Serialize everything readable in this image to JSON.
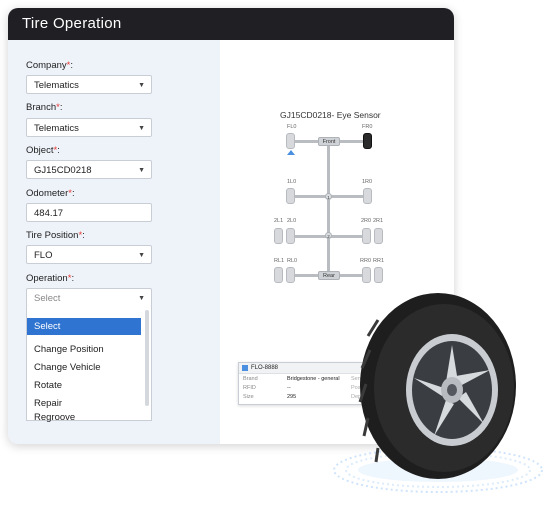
{
  "window": {
    "title": "Tire Operation"
  },
  "form": {
    "company": {
      "label": "Company",
      "required": "*",
      "suffix": ":",
      "value": "Telematics"
    },
    "branch": {
      "label": "Branch",
      "required": "*",
      "suffix": ":",
      "value": "Telematics"
    },
    "object": {
      "label": "Object",
      "required": "*",
      "suffix": ":",
      "value": "GJ15CD0218"
    },
    "odometer": {
      "label": "Odometer",
      "required": "*",
      "suffix": ":",
      "value": "484.17"
    },
    "tire_position": {
      "label": "Tire Position",
      "required": "*",
      "suffix": ":",
      "value": "FLO"
    },
    "operation": {
      "label": "Operation",
      "required": "*",
      "suffix": ":",
      "placeholder": "Select",
      "options": [
        "Select",
        "Change Position",
        "Change Vehicle",
        "Rotate",
        "Repair",
        "Regroove"
      ],
      "selected": "Select"
    }
  },
  "diagram": {
    "title": "GJ15CD0218- Eye Sensor",
    "tires": {
      "FL0": "FL0",
      "FR0": "FR0",
      "1L0": "1L0",
      "1R0": "1R0",
      "2L1": "2L1",
      "2L0": "2L0",
      "2R0": "2R0",
      "2R1": "2R1",
      "RL1": "RL1",
      "RL0": "RL0",
      "RR0": "RR0",
      "RR1": "RR1"
    },
    "front_label": "Front",
    "rear_label": "Rear",
    "axle_1": "1",
    "axle_2": "2"
  },
  "info_panel": {
    "header": "FLO-8888",
    "rows": [
      {
        "key": "Brand",
        "value": "Bridgestone - general",
        "key2": "Sensor"
      },
      {
        "key": "RFID",
        "value": "--",
        "key2": "Positi"
      },
      {
        "key": "Size",
        "value": "295",
        "key2": "Depth"
      }
    ]
  },
  "colors": {
    "titlebar": "#1f1f24",
    "selected_option": "#2f74d0",
    "required": "#e53935"
  }
}
